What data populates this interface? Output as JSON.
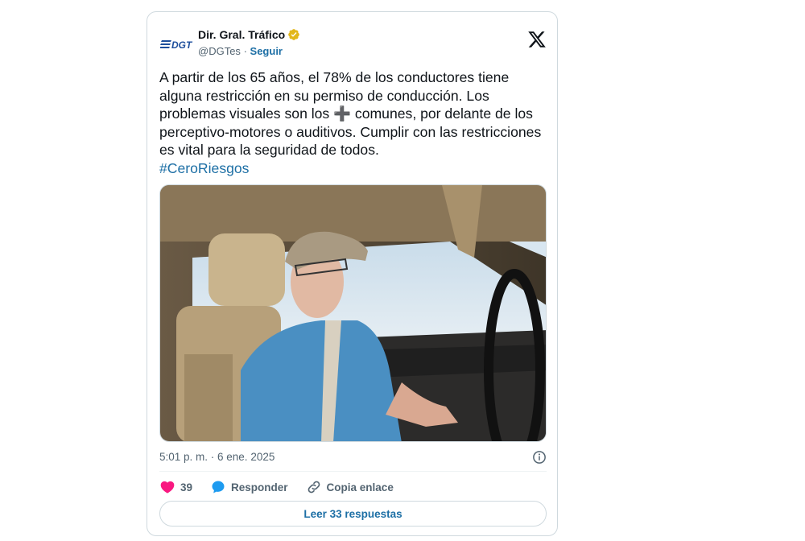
{
  "author": {
    "name": "Dir. Gral. Tráfico",
    "handle": "@DGTes",
    "separator": "·",
    "follow_label": "Seguir",
    "logo_text": "DGT"
  },
  "tweet": {
    "line1": "A partir de los 65 años, el 78% de los conductores tiene alguna restricción en su permiso de conducción. Los problemas visuales son los ",
    "plus_symbol": "➕",
    "line2": " comunes, por delante de los perceptivo-motores o auditivos. Cumplir con las restricciones es vital para la seguridad de todos.",
    "hashtag": "#CeroRiesgos"
  },
  "meta": {
    "timestamp": "5:01 p. m. · 6 ene. 2025"
  },
  "actions": {
    "like_count": "39",
    "reply_label": "Responder",
    "copy_label": "Copia enlace"
  },
  "read_replies_label": "Leer 33 respuestas",
  "colors": {
    "link": "#1d6fa5",
    "like": "#f91880",
    "verified": "#e2b719",
    "dgt_blue": "#1d4e9c"
  }
}
